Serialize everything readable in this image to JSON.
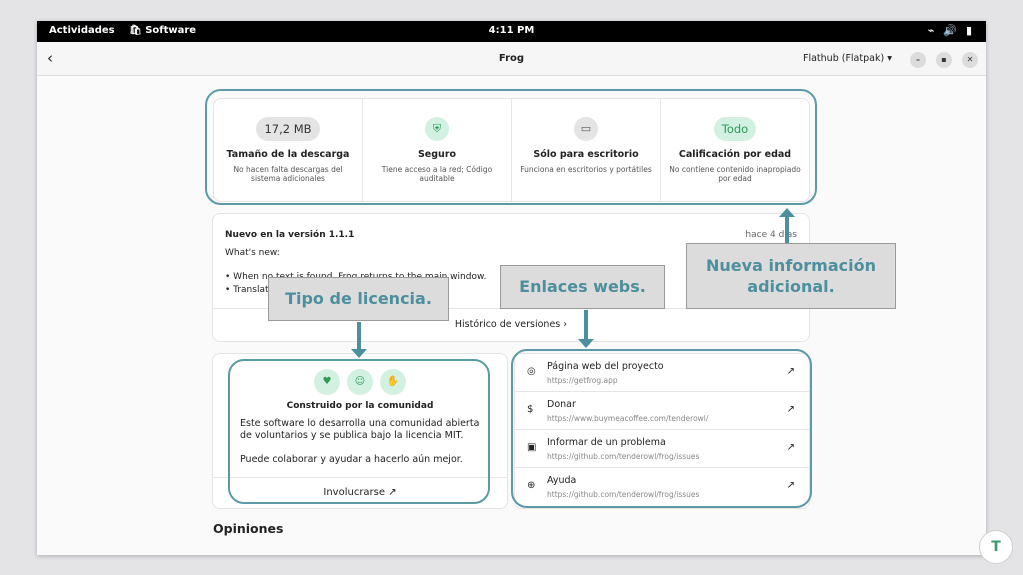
{
  "topbar": {
    "activities": "Actividades",
    "app_name": "Software",
    "time": "4:11 PM"
  },
  "header": {
    "title": "Frog",
    "source_select": "Flathub (Flatpak)",
    "back_icon": "back-arrow-icon"
  },
  "info_tiles": [
    {
      "badge": "17,2 MB",
      "title": "Tamaño de la descarga",
      "subtitle": "No hacen falta descargas del sistema adicionales"
    },
    {
      "badge": "",
      "title": "Seguro",
      "subtitle": "Tiene acceso a la red; Código auditable"
    },
    {
      "badge": "",
      "title": "Sólo para escritorio",
      "subtitle": "Funciona en escritorios y portátiles"
    },
    {
      "badge": "Todo",
      "title": "Calificación por edad",
      "subtitle": "No contiene contenido inapropiado por edad"
    }
  ],
  "version": {
    "title": "Nuevo en la versión 1.1.1",
    "when": "hace 4 días",
    "whats_new": "What's new:",
    "bullet1": "• When no text is found, Frog returns to the main window.",
    "bullet2": "• Translations updated.",
    "history": "Histórico de versiones"
  },
  "license": {
    "title": "Construido por la comunidad",
    "body1": "Este software lo desarrolla una comunidad abierta de voluntarios y se publica bajo la licencia MIT.",
    "body2": "Puede colaborar y ayudar a hacerlo aún mejor.",
    "link": "Involucrarse"
  },
  "links": [
    {
      "label": "Página web del proyecto",
      "url": "https://getfrog.app",
      "icon": "globe-icon"
    },
    {
      "label": "Donar",
      "url": "https://www.buymeacoffee.com/tenderowl/",
      "icon": "dollar-icon"
    },
    {
      "label": "Informar de un problema",
      "url": "https://github.com/tenderowl/frog/issues",
      "icon": "bug-report-icon"
    },
    {
      "label": "Ayuda",
      "url": "https://github.com/tenderowl/frog/issues",
      "icon": "help-icon"
    }
  ],
  "reviews_title": "Opiniones",
  "callouts": {
    "license": "Tipo de licencia.",
    "links": "Enlaces webs.",
    "info": "Nueva información adicional."
  },
  "colors": {
    "accent": "#5b9aa6",
    "green": "#2b9b56"
  }
}
